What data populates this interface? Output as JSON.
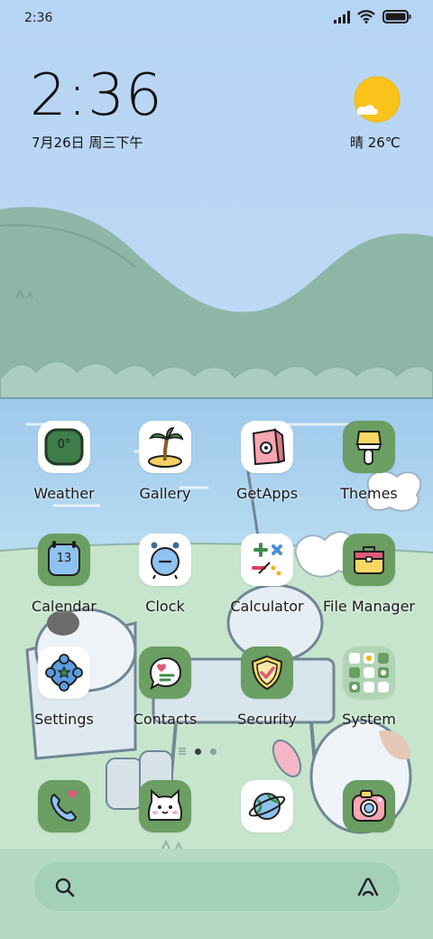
{
  "status_bar": {
    "time": "2:36",
    "icons": [
      "signal-icon",
      "wifi-icon",
      "battery-icon"
    ]
  },
  "clock_widget": {
    "time": "2:36",
    "date": "7月26日 周三下午"
  },
  "weather_widget": {
    "condition_temp": "晴 26℃",
    "icon": "sun-cloud-icon"
  },
  "apps_row1": [
    {
      "label": "Weather",
      "icon": "weather-icon"
    },
    {
      "label": "Gallery",
      "icon": "palm-island-icon"
    },
    {
      "label": "GetApps",
      "icon": "shopping-bag-icon"
    },
    {
      "label": "Themes",
      "icon": "paint-brush-icon"
    }
  ],
  "apps_row2": [
    {
      "label": "Calendar",
      "icon": "calendar-icon",
      "badge": "13"
    },
    {
      "label": "Clock",
      "icon": "alarm-clock-icon"
    },
    {
      "label": "Calculator",
      "icon": "calculator-icon"
    },
    {
      "label": "File Manager",
      "icon": "briefcase-icon"
    }
  ],
  "apps_row3": [
    {
      "label": "Settings",
      "icon": "gear-flower-icon"
    },
    {
      "label": "Contacts",
      "icon": "chat-bubble-icon"
    },
    {
      "label": "Security",
      "icon": "shield-check-icon"
    },
    {
      "label": "System",
      "icon": "folder-grid-icon"
    }
  ],
  "weather_tile_value": "0°",
  "dock": [
    {
      "name": "phone",
      "icon": "phone-icon"
    },
    {
      "name": "messaging",
      "icon": "cat-face-icon"
    },
    {
      "name": "browser",
      "icon": "planet-icon"
    },
    {
      "name": "camera",
      "icon": "camera-icon"
    }
  ],
  "page_indicator": {
    "pages": 2,
    "current": 1
  },
  "search_bar": {
    "left_icon": "search-icon",
    "right_icon": "assistant-icon"
  },
  "colors": {
    "sky": "#bcd8f4",
    "hill": "#8fb7a8",
    "grass": "#c4e2c8",
    "tile_green": "#6a9e62",
    "sun": "#f9c31c"
  }
}
